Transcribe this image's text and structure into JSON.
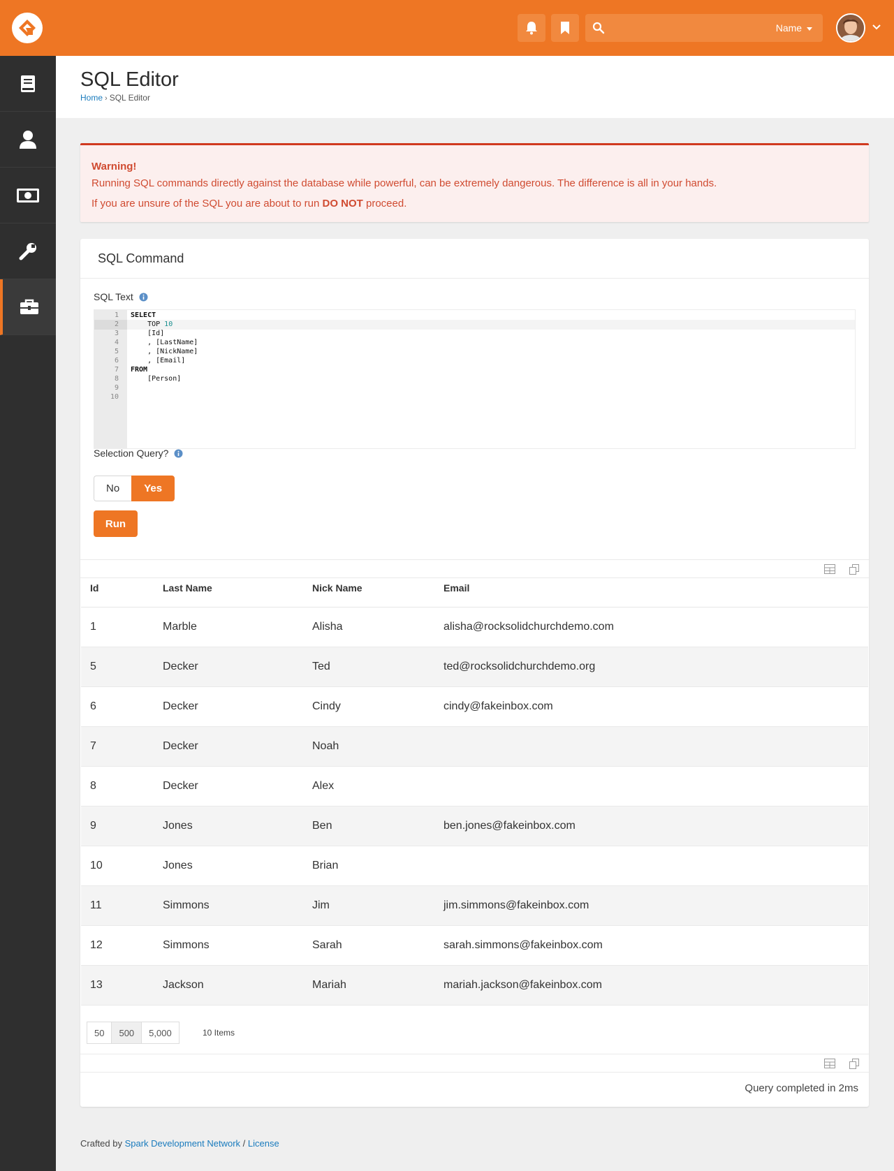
{
  "header": {
    "search_filter": "Name",
    "search_placeholder": ""
  },
  "icons": {
    "logo": "rock-logo-icon",
    "notifications": "bell-icon",
    "bookmarks": "bookmark-icon",
    "search": "search-icon",
    "sidebar": [
      "book-icon",
      "person-icon",
      "money-icon",
      "wrench-icon",
      "briefcase-icon"
    ]
  },
  "colors": {
    "brand": "#ee7624",
    "warning_text": "#d04b31",
    "link": "#1a7bbd"
  },
  "page": {
    "title": "SQL Editor",
    "breadcrumb_home": "Home",
    "breadcrumb_current": "SQL Editor"
  },
  "warning": {
    "title": "Warning!",
    "line1": "Running SQL commands directly against the database while powerful, can be extremely dangerous. The difference is all in your hands.",
    "line2_prefix": "If you are unsure of the SQL you are about to run ",
    "line2_bold": "DO NOT",
    "line2_suffix": " proceed."
  },
  "panel": {
    "title": "SQL Command",
    "sql_text_label": "SQL Text",
    "selection_query_label": "Selection Query?",
    "toggle_no": "No",
    "toggle_yes": "Yes",
    "run_label": "Run"
  },
  "editor": {
    "line_numbers": [
      "1",
      "2",
      "3",
      "4",
      "5",
      "6",
      "7",
      "8",
      "9",
      "10"
    ],
    "lines": [
      {
        "kw": "SELECT",
        "text": "",
        "num": ""
      },
      {
        "kw": "",
        "text": "    TOP ",
        "num": "10"
      },
      {
        "kw": "",
        "text": "    [Id]",
        "num": ""
      },
      {
        "kw": "",
        "text": "    , [LastName]",
        "num": ""
      },
      {
        "kw": "",
        "text": "    , [NickName]",
        "num": ""
      },
      {
        "kw": "",
        "text": "    , [Email]",
        "num": ""
      },
      {
        "kw": "FROM",
        "text": "",
        "num": ""
      },
      {
        "kw": "",
        "text": "    [Person]",
        "num": ""
      },
      {
        "kw": "",
        "text": "",
        "num": ""
      },
      {
        "kw": "",
        "text": "",
        "num": ""
      }
    ]
  },
  "grid": {
    "columns": [
      "Id",
      "Last Name",
      "Nick Name",
      "Email"
    ],
    "rows": [
      [
        "1",
        "Marble",
        "Alisha",
        "alisha@rocksolidchurchdemo.com"
      ],
      [
        "5",
        "Decker",
        "Ted",
        "ted@rocksolidchurchdemo.org"
      ],
      [
        "6",
        "Decker",
        "Cindy",
        "cindy@fakeinbox.com"
      ],
      [
        "7",
        "Decker",
        "Noah",
        ""
      ],
      [
        "8",
        "Decker",
        "Alex",
        ""
      ],
      [
        "9",
        "Jones",
        "Ben",
        "ben.jones@fakeinbox.com"
      ],
      [
        "10",
        "Jones",
        "Brian",
        ""
      ],
      [
        "11",
        "Simmons",
        "Jim",
        "jim.simmons@fakeinbox.com"
      ],
      [
        "12",
        "Simmons",
        "Sarah",
        "sarah.simmons@fakeinbox.com"
      ],
      [
        "13",
        "Jackson",
        "Mariah",
        "mariah.jackson@fakeinbox.com"
      ]
    ],
    "page_sizes": [
      "50",
      "500",
      "5,000"
    ],
    "selected_page_size": "500",
    "item_count": "10 Items",
    "status": "Query completed in 2ms"
  },
  "footer": {
    "prefix": "Crafted by ",
    "link1": "Spark Development Network",
    "sep": " / ",
    "link2": "License"
  }
}
